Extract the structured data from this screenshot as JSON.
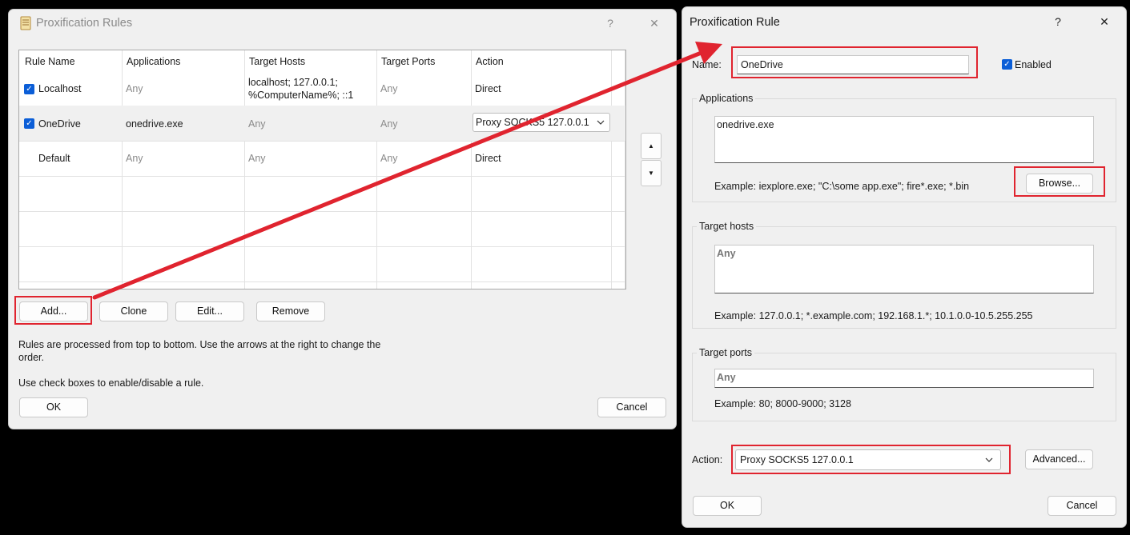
{
  "rules_window": {
    "title": "Proxification Rules",
    "help": "?",
    "close": "✕",
    "columns": [
      "Rule Name",
      "Applications",
      "Target Hosts",
      "Target Ports",
      "Action"
    ],
    "rows": [
      {
        "name": "Localhost",
        "apps": "Any",
        "hosts_line1": "localhost; 127.0.0.1;",
        "hosts_line2": "%ComputerName%; ::1",
        "ports": "Any",
        "action": "Direct",
        "enabled": true
      },
      {
        "name": "OneDrive",
        "apps": "onedrive.exe",
        "hosts": "Any",
        "ports": "Any",
        "action": "Proxy SOCKS5 127.0.0.1",
        "enabled": true
      },
      {
        "name": "Default",
        "apps": "Any",
        "hosts": "Any",
        "ports": "Any",
        "action": "Direct"
      }
    ],
    "buttons": {
      "add": "Add...",
      "clone": "Clone",
      "edit": "Edit...",
      "remove": "Remove",
      "ok": "OK",
      "cancel": "Cancel",
      "up": "▲",
      "down": "▼"
    },
    "info_line1": "Rules are processed from top to bottom. Use the arrows at the right to change the",
    "info_line2": "order.",
    "info_line3": "Use check boxes to enable/disable a rule."
  },
  "rule_window": {
    "title": "Proxification Rule",
    "help": "?",
    "close": "✕",
    "name_label": "Name:",
    "name_value": "OneDrive",
    "enabled_label": "Enabled",
    "applications_label": "Applications",
    "applications_value": "onedrive.exe",
    "applications_example": "Example: iexplore.exe; \"C:\\some app.exe\"; fire*.exe; *.bin",
    "browse": "Browse...",
    "target_hosts_label": "Target hosts",
    "target_hosts_value": "Any",
    "target_hosts_example": "Example: 127.0.0.1; *.example.com; 192.168.1.*; 10.1.0.0-10.5.255.255",
    "target_ports_label": "Target ports",
    "target_ports_value": "Any",
    "target_ports_example": "Example: 80; 8000-9000; 3128",
    "action_label": "Action:",
    "action_value": "Proxy SOCKS5 127.0.0.1",
    "advanced": "Advanced...",
    "ok": "OK",
    "cancel": "Cancel"
  },
  "colors": {
    "highlight": "#e0242f",
    "checkbox": "#0b5ed7"
  }
}
